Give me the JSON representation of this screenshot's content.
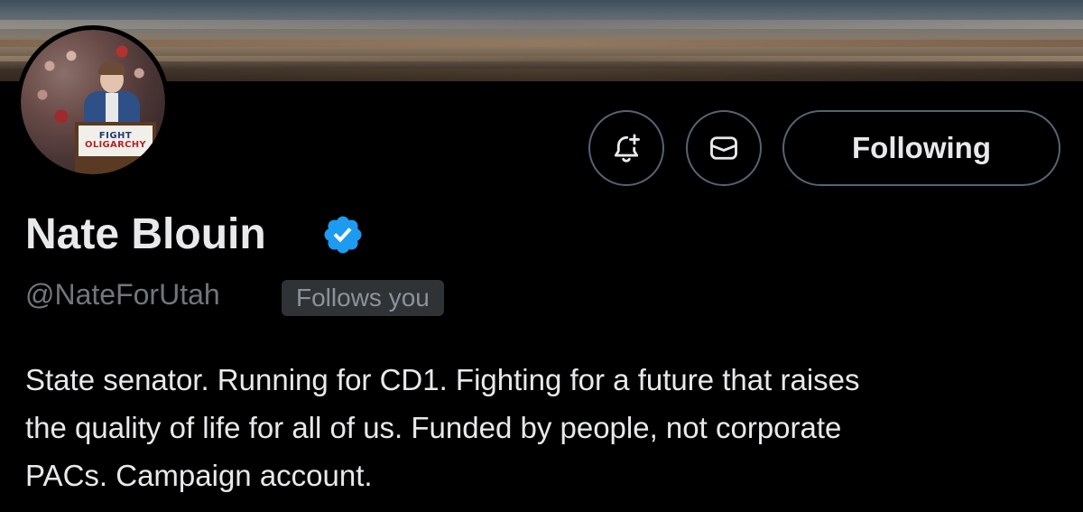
{
  "profile": {
    "display_name": "Nate Blouin",
    "handle": "@NateForUtah",
    "follows_you_label": "Follows you",
    "verified": true,
    "bio_lines": [
      "State senator. Running for CD1. Fighting for a future that raises",
      "the quality of life for all of us. Funded by people, not corporate",
      "PACs. Campaign account."
    ]
  },
  "avatar": {
    "sign_line_1": "FIGHT",
    "sign_line_2": "OLIGARCHY"
  },
  "actions": {
    "notify_icon": "bell-plus-icon",
    "message_icon": "envelope-icon",
    "follow_label": "Following"
  },
  "colors": {
    "background": "#000000",
    "text_primary": "#e7e9ea",
    "text_secondary": "#71767b",
    "button_border": "#536471",
    "verified_blue": "#1d9bf0",
    "badge_bg": "#2f3336"
  }
}
